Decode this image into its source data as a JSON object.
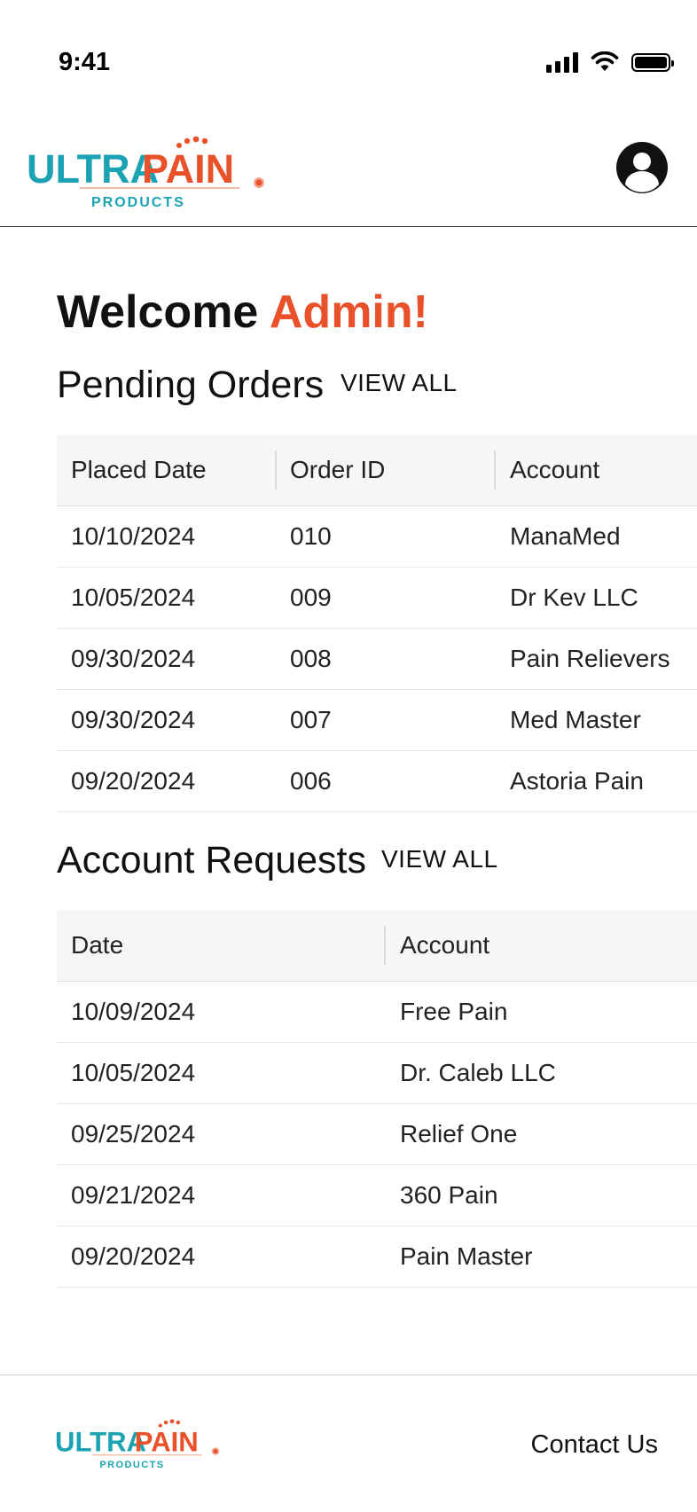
{
  "status_bar": {
    "time": "9:41"
  },
  "brand": {
    "name_part1": "ULTRA",
    "name_part2": "PAIN",
    "tagline": "PRODUCTS",
    "teal": "#1ba3b3",
    "orange": "#e8512a"
  },
  "welcome": {
    "prefix": "Welcome ",
    "name": "Admin!"
  },
  "pending_orders": {
    "title": "Pending Orders",
    "view_all": "VIEW ALL",
    "columns": [
      "Placed Date",
      "Order ID",
      "Account"
    ],
    "rows": [
      [
        "10/10/2024",
        "010",
        "ManaMed"
      ],
      [
        "10/05/2024",
        "009",
        "Dr Kev LLC"
      ],
      [
        "09/30/2024",
        "008",
        "Pain Relievers"
      ],
      [
        "09/30/2024",
        "007",
        "Med Master"
      ],
      [
        "09/20/2024",
        "006",
        "Astoria Pain"
      ]
    ]
  },
  "account_requests": {
    "title": "Account Requests",
    "view_all": "VIEW ALL",
    "columns": [
      "Date",
      "Account"
    ],
    "rows": [
      [
        "10/09/2024",
        "Free Pain"
      ],
      [
        "10/05/2024",
        "Dr. Caleb LLC"
      ],
      [
        "09/25/2024",
        "Relief One"
      ],
      [
        "09/21/2024",
        "360 Pain"
      ],
      [
        "09/20/2024",
        "Pain Master"
      ]
    ]
  },
  "footer": {
    "contact": "Contact Us"
  }
}
